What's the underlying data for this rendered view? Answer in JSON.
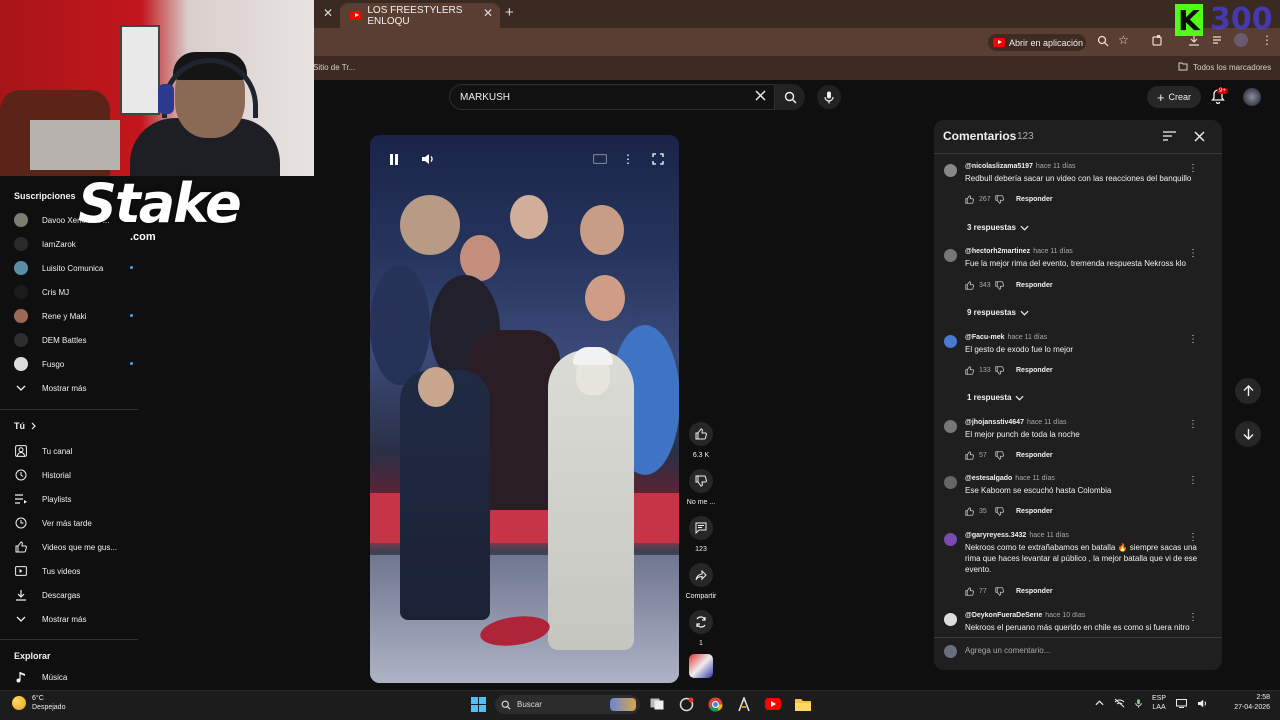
{
  "browser": {
    "tab_title": "LOS FREESTYLERS ENLOQU",
    "open_in_app": "Abrir en aplicación",
    "bookmark_left": "Sitio de Tr...",
    "bookmarks_all": "Todos los marcadores"
  },
  "overlay": {
    "stake": "Stake",
    "stake_com": ".com",
    "k_letter": "K",
    "k_number": "300"
  },
  "header": {
    "search_value": "MARKUSH",
    "create_label": "Crear",
    "notif_count": "9+"
  },
  "sidebar": {
    "subscriptions_title": "Suscripciones",
    "channels": [
      {
        "name": "Davoo Xeneize P...",
        "color": "#7a7f70",
        "live": false
      },
      {
        "name": "IamZarok",
        "color": "#2a2a2a",
        "live": false
      },
      {
        "name": "Luisito Comunica",
        "color": "#5b8fa8",
        "live": true
      },
      {
        "name": "Cris MJ",
        "color": "#1b1b1b",
        "live": false
      },
      {
        "name": "Rene y Maki",
        "color": "#9b6b55",
        "live": true
      },
      {
        "name": "DEM Battles",
        "color": "#2e2e2e",
        "live": false
      },
      {
        "name": "Fusgo",
        "color": "#dcdcdc",
        "live": true
      }
    ],
    "show_more_1": "Mostrar más",
    "you_title": "Tú",
    "you_items": [
      {
        "label": "Tu canal",
        "icon": "user-square-icon"
      },
      {
        "label": "Historial",
        "icon": "history-icon"
      },
      {
        "label": "Playlists",
        "icon": "playlist-icon"
      },
      {
        "label": "Ver más tarde",
        "icon": "clock-icon"
      },
      {
        "label": "Videos que me gus...",
        "icon": "thumb-up-icon"
      },
      {
        "label": "Tus videos",
        "icon": "video-icon"
      },
      {
        "label": "Descargas",
        "icon": "download-icon"
      }
    ],
    "show_more_2": "Mostrar más",
    "explore_title": "Explorar",
    "music_label": "Música"
  },
  "actions": {
    "likes": "6.3 K",
    "dislike": "No me ...",
    "comments": "123",
    "share": "Compartir",
    "remix": "1"
  },
  "comments": {
    "title": "Comentarios",
    "count": "123",
    "items": [
      {
        "author": "@nicolaslizama5197",
        "time": "hace 11 días",
        "text": "Redbull debería sacar un video con las reacciones del banquillo",
        "likes": "267",
        "reply": "Responder",
        "replies": "3 respuestas",
        "color": "#888"
      },
      {
        "author": "@hectorh2martinez",
        "time": "hace 11 días",
        "text": "Fue la mejor rima del evento, tremenda respuesta Nekross klo",
        "likes": "343",
        "reply": "Responder",
        "replies": "9 respuestas",
        "color": "#777"
      },
      {
        "author": "@Facu-mek",
        "time": "hace 11 días",
        "text": "El gesto de exodo fue lo mejor",
        "likes": "133",
        "reply": "Responder",
        "replies": "1 respuesta",
        "color": "#4a7ad0"
      },
      {
        "author": "@jhojansstiv4647",
        "time": "hace 11 días",
        "text": "El mejor punch de toda la noche",
        "likes": "57",
        "reply": "Responder",
        "replies": "",
        "color": "#777"
      },
      {
        "author": "@estesalgado",
        "time": "hace 11 días",
        "text": "Ese Kaboom se escuchó hasta Colombia",
        "likes": "35",
        "reply": "Responder",
        "replies": "",
        "color": "#666"
      },
      {
        "author": "@garyreyess.3432",
        "time": "hace 11 días",
        "text": "Nekroos como te extrañabamos en batalla 🔥 siempre sacas una rima que haces levantar al público , la mejor batalla que vi de ese evento.",
        "likes": "77",
        "reply": "Responder",
        "replies": "",
        "color": "#7a4ab0"
      },
      {
        "author": "@DeykonFueraDeSerie",
        "time": "hace 10 días",
        "text": "Nekroos el peruano más querido en chile es como si fuera nitro",
        "likes": "",
        "reply": "",
        "replies": "",
        "color": "#ddd"
      }
    ],
    "add_placeholder": "Agrega un comentario..."
  },
  "taskbar": {
    "temp": "6°C",
    "weather": "Despejado",
    "search": "Buscar",
    "lang1": "ESP",
    "lang2": "LAA",
    "time": "2:58",
    "date": "27-04-2026"
  }
}
